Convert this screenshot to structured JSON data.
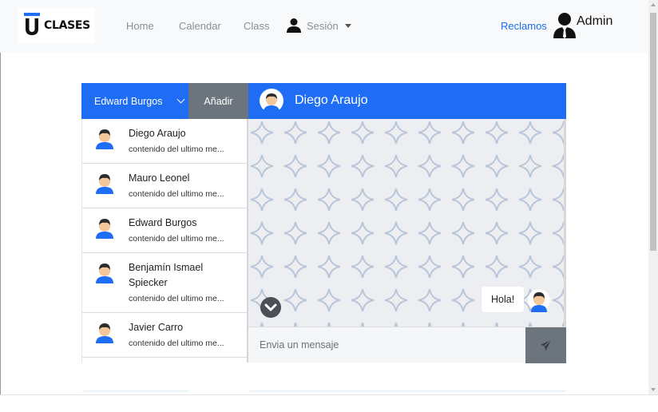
{
  "navbar": {
    "brand_text": "CLASES",
    "links": {
      "home": "Home",
      "calendar": "Calendar",
      "class": "Class",
      "session": "Sesión"
    },
    "reclamos": "Reclamos",
    "admin": "Admin"
  },
  "chat": {
    "selected_user": "Edward Burgos",
    "add_label": "Añadir",
    "active_contact": "Diego Araujo",
    "contacts": [
      {
        "name": "Diego Araujo",
        "preview": "contenido del ultimo me..."
      },
      {
        "name": "Mauro Leonel",
        "preview": "contenido del ultimo me..."
      },
      {
        "name": "Edward Burgos",
        "preview": "contenido del ultimo me..."
      },
      {
        "name": "Benjamín Ismael Spiecker",
        "preview": "contenido del ultimo me..."
      },
      {
        "name": "Javier Carro",
        "preview": "contenido del ultimo me..."
      }
    ],
    "messages": [
      {
        "text": "Hola!"
      }
    ],
    "input_placeholder": "Envia un mensaje"
  },
  "colors": {
    "primary": "#1f6df5",
    "secondary": "#6c757d",
    "navbar_bg": "#f8f9fa",
    "link": "#1a6ef0"
  }
}
